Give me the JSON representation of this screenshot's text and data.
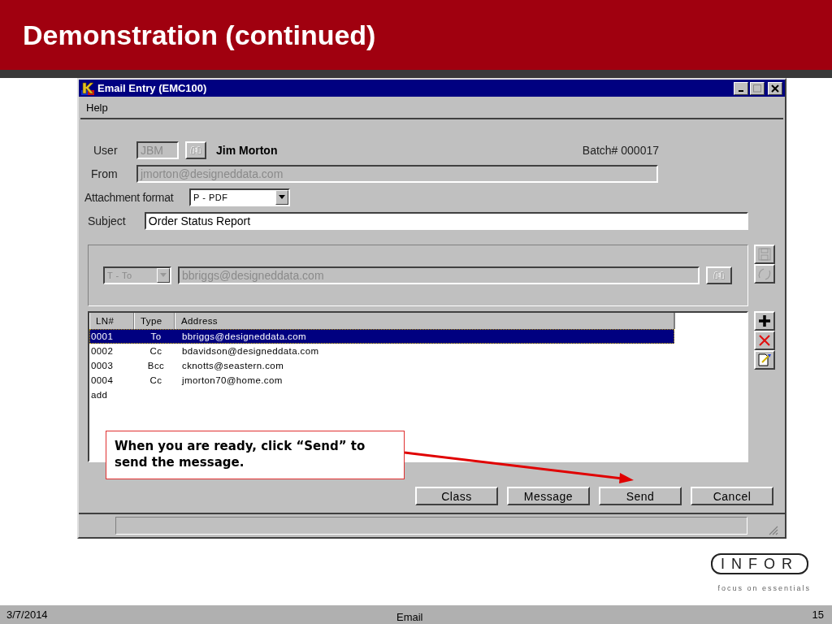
{
  "slide": {
    "title": "Demonstration (continued)",
    "date": "3/7/2014",
    "footer": "Email",
    "page": "15"
  },
  "logo": {
    "text": "INFOR",
    "tagline": "focus on essentials"
  },
  "window": {
    "title": "Email Entry (EMC100)"
  },
  "menu": [
    {
      "label": "Help"
    }
  ],
  "form": {
    "user_label": "User",
    "user_code": "JBM",
    "user_code_disabled": true,
    "user_name": "Jim Morton",
    "batch": "Batch# 000017",
    "from_label": "From",
    "from_value": "jmorton@designeddata.com",
    "from_disabled": true,
    "attachment_label": "Attachment format",
    "attachment_value": "P - PDF",
    "subject_label": "Subject",
    "subject_value": "Order Status Report"
  },
  "recipient": {
    "type": "T - To",
    "address": "bbriggs@designeddata.com",
    "disabled": true
  },
  "table": {
    "columns": [
      "LN#",
      "Type",
      "Address"
    ],
    "rows": [
      {
        "ln": "0001",
        "type": "To",
        "address": "bbriggs@designeddata.com",
        "selected": true
      },
      {
        "ln": "0002",
        "type": "Cc",
        "address": "bdavidson@designeddata.com",
        "selected": false
      },
      {
        "ln": "0003",
        "type": "Bcc",
        "address": "cknotts@seastern.com",
        "selected": false
      },
      {
        "ln": "0004",
        "type": "Cc",
        "address": "jmorton70@home.com",
        "selected": false
      }
    ],
    "add_row": "add"
  },
  "callout": {
    "text": "When you are ready, click “Send” to send the message."
  },
  "buttons": [
    "Class",
    "Message",
    "Send",
    "Cancel"
  ]
}
